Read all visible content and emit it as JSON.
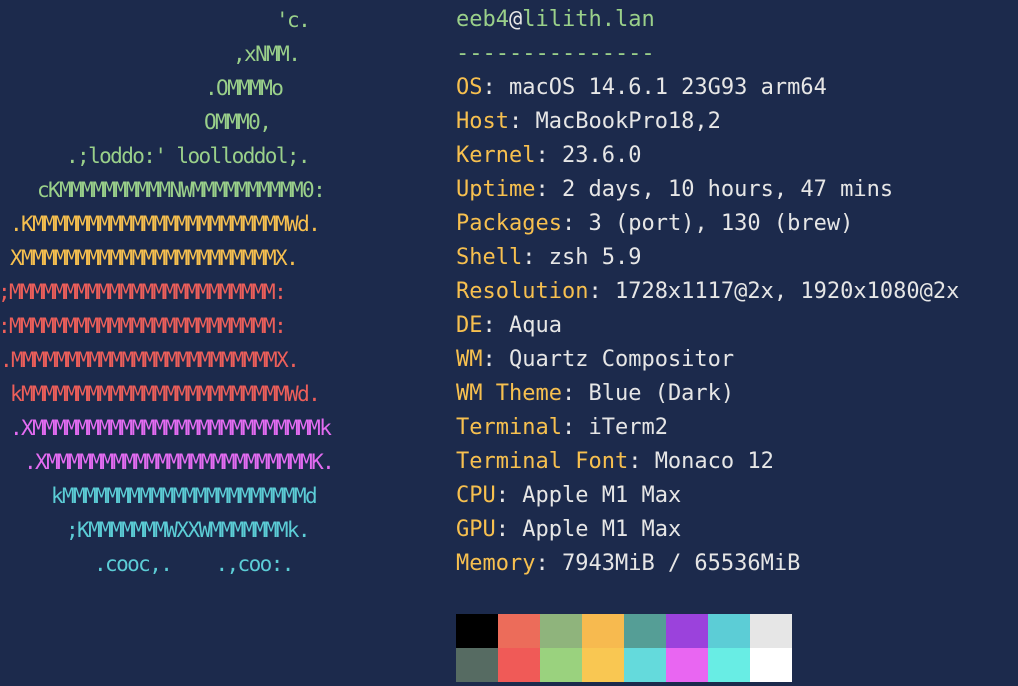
{
  "logo": {
    "lines": [
      {
        "text": "'c.",
        "color": "#9ad08a"
      },
      {
        "text": ",xNMM.",
        "color": "#9ad08a"
      },
      {
        "text": ".OMMMMo",
        "color": "#9ad08a"
      },
      {
        "text": "OMMM0,",
        "color": "#9ad08a"
      },
      {
        "text": ".;loddo:' loolloddol;.",
        "color": "#9ad08a"
      },
      {
        "text": "cKMMMMMMMMMMNWMMMMMMMMMM0:",
        "color": "#9ad08a"
      },
      {
        "text": ".KMMMMMMMMMMMMMMMMMMMMMMMWd.",
        "color": "#f7c04f"
      },
      {
        "text": "XMMMMMMMMMMMMMMMMMMMMMMMX.",
        "color": "#f7c04f"
      },
      {
        "text": ";MMMMMMMMMMMMMMMMMMMMMMMM:",
        "color": "#ed5f5a"
      },
      {
        "text": ":MMMMMMMMMMMMMMMMMMMMMMMM:",
        "color": "#ed5f5a"
      },
      {
        "text": ".MMMMMMMMMMMMMMMMMMMMMMMMX.",
        "color": "#ed5f5a"
      },
      {
        "text": "kMMMMMMMMMMMMMMMMMMMMMMMMWd.",
        "color": "#ed5f5a"
      },
      {
        "text": ".XMMMMMMMMMMMMMMMMMMMMMMMMMMk",
        "color": "#e46cf2"
      },
      {
        "text": ".XMMMMMMMMMMMMMMMMMMMMMMMMK.",
        "color": "#e46cf2"
      },
      {
        "text": "kMMMMMMMMMMMMMMMMMMMMMMd",
        "color": "#5ccdd6"
      },
      {
        "text": ";KMMMMMMMWXXWMMMMMMMk.",
        "color": "#5ccdd6"
      },
      {
        "text": ".cooc,.    .,coo:.",
        "color": "#5ccdd6"
      }
    ]
  },
  "header": {
    "user": "eeb4",
    "at": "@",
    "host": "lilith.lan",
    "separator": "---------------"
  },
  "info": [
    {
      "key": "OS",
      "value": "macOS 14.6.1 23G93 arm64"
    },
    {
      "key": "Host",
      "value": "MacBookPro18,2"
    },
    {
      "key": "Kernel",
      "value": "23.6.0"
    },
    {
      "key": "Uptime",
      "value": "2 days, 10 hours, 47 mins"
    },
    {
      "key": "Packages",
      "value": "3 (port), 130 (brew)"
    },
    {
      "key": "Shell",
      "value": "zsh 5.9"
    },
    {
      "key": "Resolution",
      "value": "1728x1117@2x, 1920x1080@2x"
    },
    {
      "key": "DE",
      "value": "Aqua"
    },
    {
      "key": "WM",
      "value": "Quartz Compositor"
    },
    {
      "key": "WM Theme",
      "value": "Blue (Dark)"
    },
    {
      "key": "Terminal",
      "value": "iTerm2"
    },
    {
      "key": "Terminal Font",
      "value": "Monaco 12"
    },
    {
      "key": "CPU",
      "value": "Apple M1 Max"
    },
    {
      "key": "GPU",
      "value": "Apple M1 Max"
    },
    {
      "key": "Memory",
      "value": "7943MiB / 65536MiB"
    }
  ],
  "key_suffix": ": ",
  "palette": {
    "normal": [
      "#000000",
      "#ec6c5a",
      "#8fb47c",
      "#f7ba4f",
      "#559e96",
      "#9b42dc",
      "#5ccdd6",
      "#e6e6e6"
    ],
    "bright": [
      "#566b62",
      "#f05a57",
      "#9ad27e",
      "#f9c752",
      "#64dadc",
      "#e966f2",
      "#68ede4",
      "#ffffff"
    ]
  }
}
